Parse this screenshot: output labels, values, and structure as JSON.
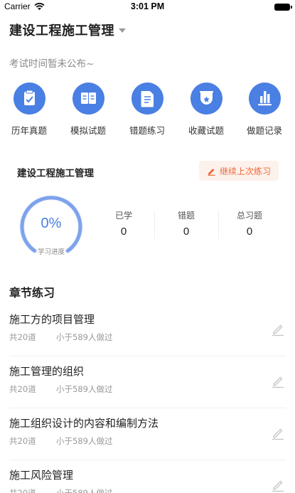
{
  "status_bar": {
    "carrier": "Carrier",
    "time": "3:01 PM"
  },
  "header": {
    "title": "建设工程施工管理"
  },
  "exam_note": "考试时间暂未公布~",
  "quick_menu": [
    {
      "label": "历年真题",
      "icon": "clipboard-check-icon"
    },
    {
      "label": "模拟试题",
      "icon": "open-book-icon"
    },
    {
      "label": "错题练习",
      "icon": "document-icon"
    },
    {
      "label": "收藏试题",
      "icon": "bookmark-star-icon"
    },
    {
      "label": "做题记录",
      "icon": "bar-chart-icon"
    }
  ],
  "progress_card": {
    "title": "建设工程施工管理",
    "continue_label": "继续上次练习",
    "progress_value": "0%",
    "progress_label": "学习进度",
    "stats": [
      {
        "label": "已学",
        "value": "0"
      },
      {
        "label": "错题",
        "value": "0"
      },
      {
        "label": "总习题",
        "value": "0"
      }
    ]
  },
  "chapters": {
    "section_title": "章节练习",
    "items": [
      {
        "title": "施工方的项目管理",
        "count": "共20道",
        "meta": "小于589人做过"
      },
      {
        "title": "施工管理的组织",
        "count": "共20道",
        "meta": "小于589人做过"
      },
      {
        "title": "施工组织设计的内容和编制方法",
        "count": "共20道",
        "meta": "小于589人做过"
      },
      {
        "title": "施工风险管理",
        "count": "共20道",
        "meta": "小于589人做过"
      }
    ]
  },
  "colors": {
    "accent_blue": "#4a7fe3",
    "accent_orange": "#ec6a3a",
    "continue_bg": "#fdf1ec"
  }
}
